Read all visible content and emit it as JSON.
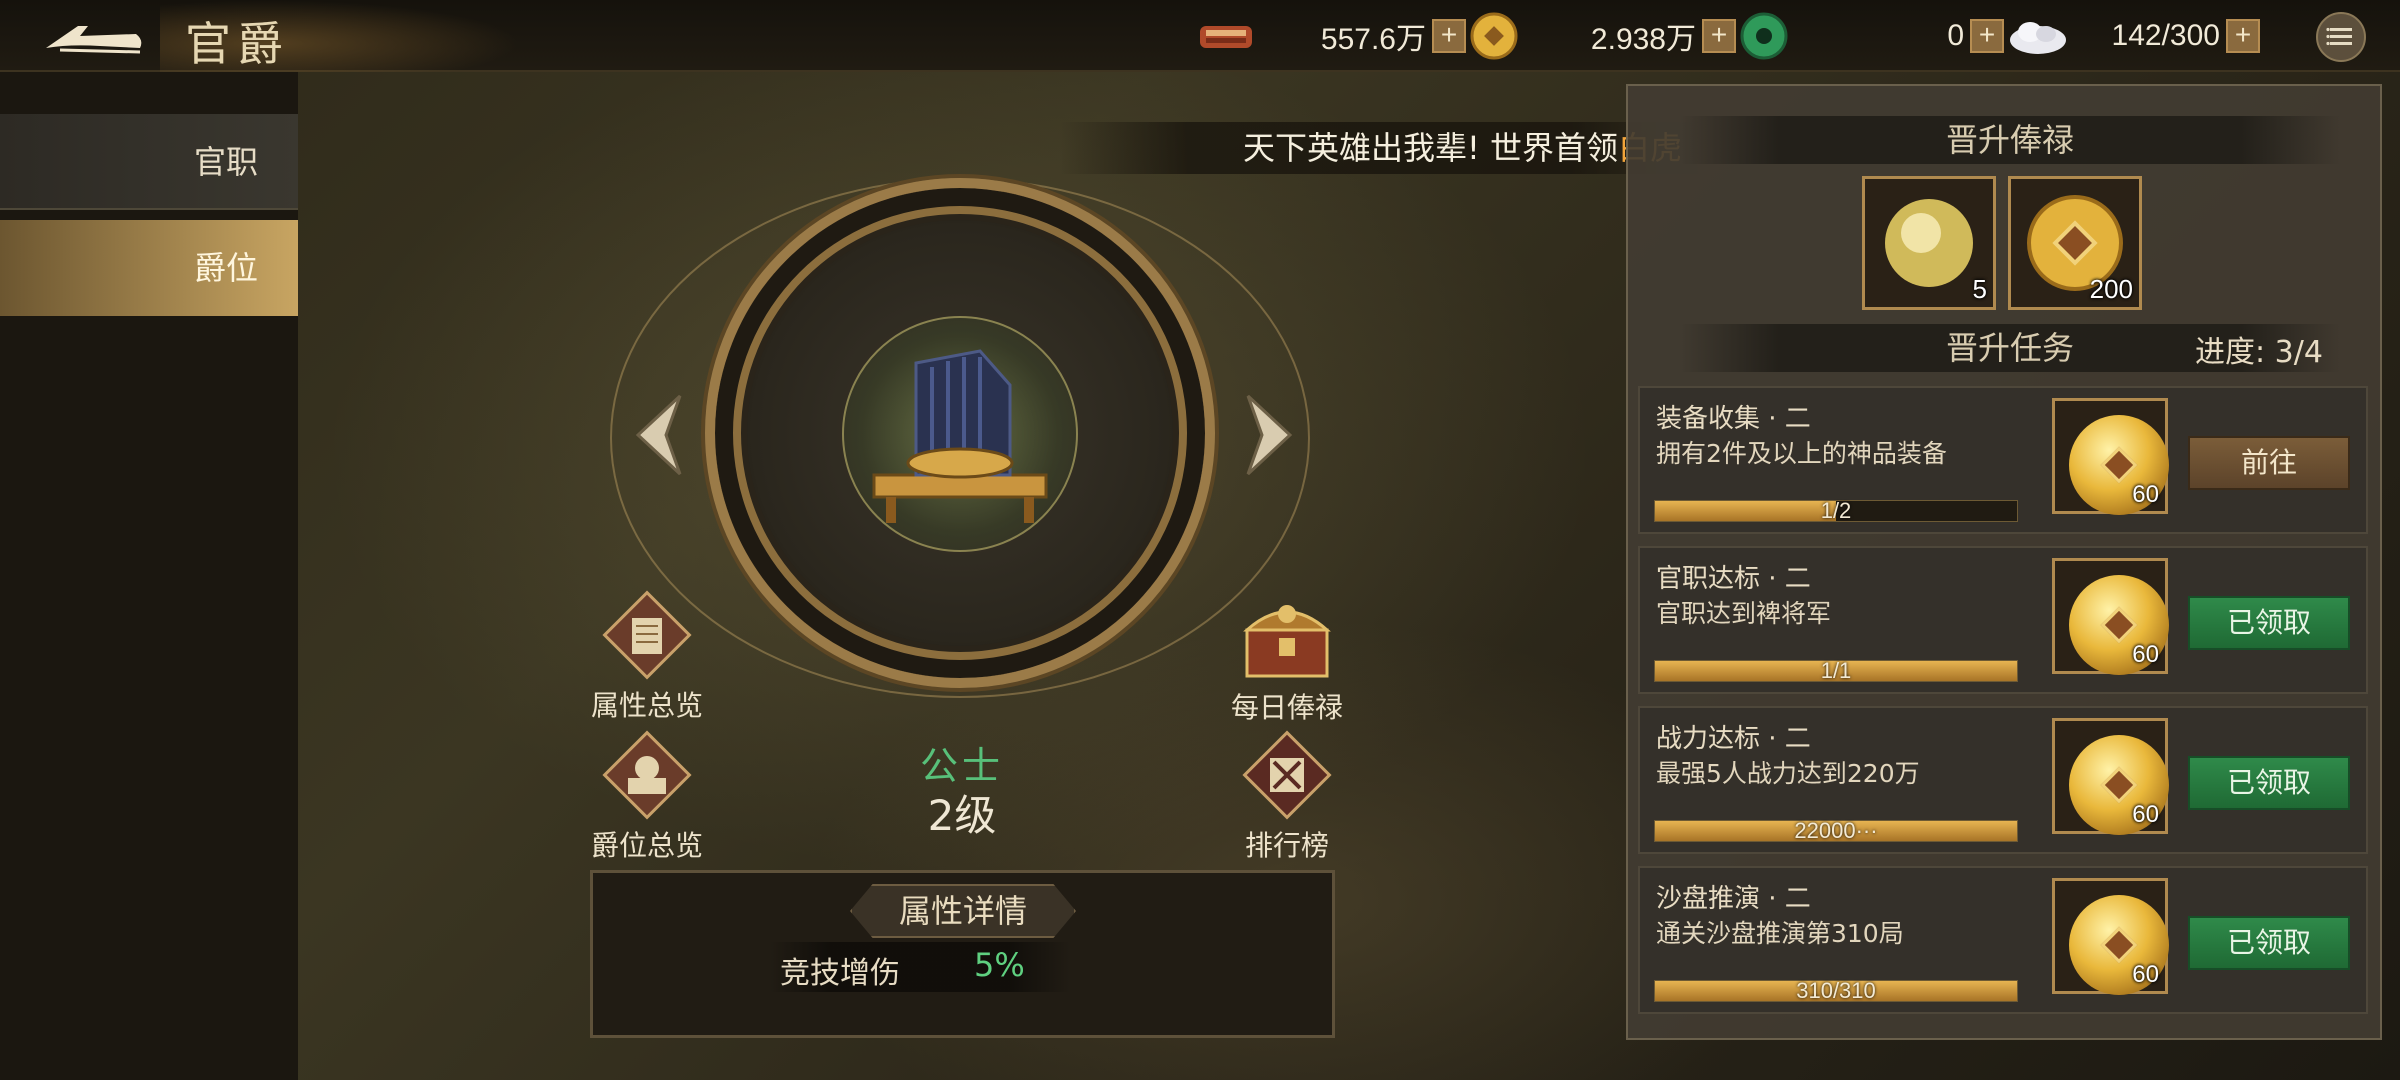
{
  "header": {
    "title": "官爵",
    "resources": [
      {
        "icon": "military-merit-icon",
        "value": "557.6万"
      },
      {
        "icon": "gold-coin-icon",
        "value": "2.938万"
      },
      {
        "icon": "jade-icon",
        "value": "0"
      },
      {
        "icon": "stamina-icon",
        "value": "142/300"
      }
    ],
    "plus_label": "+"
  },
  "sidebar": {
    "items": [
      {
        "label": "官职",
        "active": false
      },
      {
        "label": "爵位",
        "active": true
      }
    ]
  },
  "banner": {
    "text": "天下英雄出我辈! 世界首领",
    "highlight": "白虎"
  },
  "features": {
    "attr_overview": "属性总览",
    "rank_overview": "爵位总览",
    "daily_salary": "每日俸禄",
    "leaderboard": "排行榜"
  },
  "rank": {
    "name": "公士",
    "level": "2级"
  },
  "attr_panel": {
    "title": "属性详情",
    "key": "竞技增伤",
    "value": "5%"
  },
  "right_panel": {
    "salary_title": "晋升俸禄",
    "rewards": [
      {
        "icon": "gold-orb-icon",
        "count": "5"
      },
      {
        "icon": "gold-coin-icon",
        "count": "200"
      }
    ],
    "tasks_title": "晋升任务",
    "progress": "进度: 3/4",
    "tasks": [
      {
        "title": "装备收集 · 二",
        "desc": "拥有2件及以上的神品装备",
        "progress_text": "1/2",
        "progress": 0.5,
        "reward_count": "60",
        "button": "前往",
        "claimed": false
      },
      {
        "title": "官职达标 · 二",
        "desc": "官职达到裨将军",
        "progress_text": "1/1",
        "progress": 1.0,
        "reward_count": "60",
        "button": "已领取",
        "claimed": true
      },
      {
        "title": "战力达标 · 二",
        "desc": "最强5人战力达到220万",
        "progress_text": "22000···",
        "progress": 1.0,
        "reward_count": "60",
        "button": "已领取",
        "claimed": true
      },
      {
        "title": "沙盘推演 · 二",
        "desc": "通关沙盘推演第310局",
        "progress_text": "310/310",
        "progress": 1.0,
        "reward_count": "60",
        "button": "已领取",
        "claimed": true
      }
    ]
  },
  "colors": {
    "accent_gold": "#c8a562",
    "rank_green": "#58c07a",
    "banner_highlight": "#f2a43b",
    "claimed_green": "#2f8a4a"
  }
}
